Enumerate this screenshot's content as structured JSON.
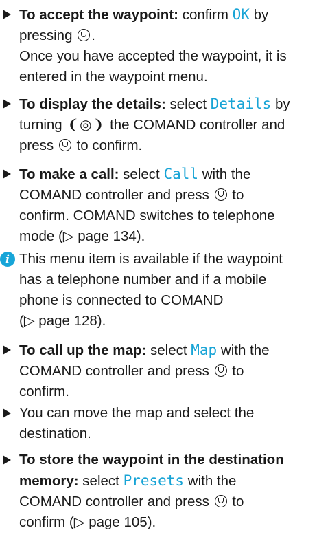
{
  "items": {
    "accept": {
      "bold": "To accept the waypoint:",
      "t1": "confirm",
      "opt": "OK",
      "t2": "by",
      "l2": "pressing",
      "l2end": ".",
      "l3": "Once you have accepted the waypoint, it is",
      "l4": "entered in the waypoint menu."
    },
    "details": {
      "bold": "To display the details:",
      "t1": "select",
      "opt": "Details",
      "t2": "by",
      "l2a": "turning",
      "l2b": "the COMAND controller and",
      "l3a": "press",
      "l3b": "to confirm."
    },
    "call": {
      "bold": "To make a call:",
      "t1": "select",
      "opt": "Call",
      "t2": "with the",
      "l2a": "COMAND controller and press",
      "l2b": "to",
      "l3": "confirm. COMAND switches to telephone",
      "l4": "mode (▷ page 134)."
    },
    "note": {
      "l1": "This menu item is available if the waypoint",
      "l2": "has a telephone number and if a mobile",
      "l3": "phone is connected to COMAND",
      "l4": "(▷ page 128)."
    },
    "map": {
      "bold": "To call up the map:",
      "t1": "select",
      "opt": "Map",
      "t2": "with the",
      "l2a": "COMAND controller and press",
      "l2b": "to",
      "l3": "confirm."
    },
    "move": {
      "l1": "You can move the map and select the",
      "l2": "destination."
    },
    "store": {
      "bold1": "To store the waypoint in the destination",
      "bold2": "memory:",
      "t1": "select",
      "opt": "Presets",
      "t2": "with the",
      "l3a": "COMAND controller and press",
      "l3b": "to",
      "l4": "confirm (▷ page 105)."
    }
  },
  "icons": {
    "bullet": "triangle-bullet-icon",
    "info": "info-icon",
    "press": "press-controller-icon",
    "turn": "turn-controller-icon"
  },
  "colors": {
    "display_text": "#18a4d6",
    "info_icon": "#17a5d8"
  }
}
